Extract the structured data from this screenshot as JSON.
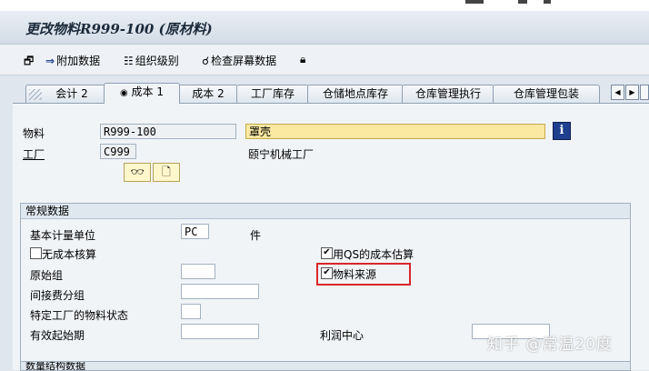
{
  "window": {
    "title": "更改物料R999-100 (原材料)"
  },
  "toolbar": {
    "items": [
      {
        "label": "",
        "icon": "select-icon"
      },
      {
        "label": "附加数据",
        "icon": "arrow-right-icon"
      },
      {
        "label": "组织级别",
        "icon": "org-hierarchy-icon"
      },
      {
        "label": "检查屏幕数据",
        "icon": "check-screen-icon"
      },
      {
        "label": "",
        "icon": "lock-icon"
      }
    ]
  },
  "tabs": [
    {
      "label": "会计 2",
      "active": false
    },
    {
      "label": "成本 1",
      "active": true
    },
    {
      "label": "成本 2",
      "active": false
    },
    {
      "label": "工厂库存",
      "active": false
    },
    {
      "label": "仓储地点库存",
      "active": false
    },
    {
      "label": "仓库管理执行",
      "active": false
    },
    {
      "label": "仓库管理包装",
      "active": false
    }
  ],
  "header": {
    "material_label": "物料",
    "material_value": "R999-100",
    "material_desc": "罩壳",
    "plant_label": "工厂",
    "plant_value": "C999",
    "plant_desc": "颐宁机械工厂"
  },
  "general": {
    "title": "常规数据",
    "base_uom_label": "基本计量单位",
    "base_uom_value": "PC",
    "base_uom_text": "件",
    "no_costing_label": "无成本核算",
    "no_costing_checked": false,
    "qs_costing_label": "用QS的成本估算",
    "qs_costing_checked": true,
    "origin_group_label": "原始组",
    "origin_group_value": "",
    "material_origin_label": "物料来源",
    "material_origin_checked": true,
    "overhead_group_label": "间接费分组",
    "overhead_group_value": "",
    "plant_status_label": "特定工厂的物料状态",
    "plant_status_value": "",
    "valid_from_label": "有效起始期",
    "valid_from_value": "",
    "profit_center_label": "利润中心",
    "profit_center_value": ""
  },
  "next_group": {
    "title": "数量结构数据"
  },
  "watermark": "知乎 @常温20度",
  "colors": {
    "highlight_field": "#fbe9a2",
    "callout_red": "#d9262a",
    "info_button": "#1f3f8f"
  }
}
